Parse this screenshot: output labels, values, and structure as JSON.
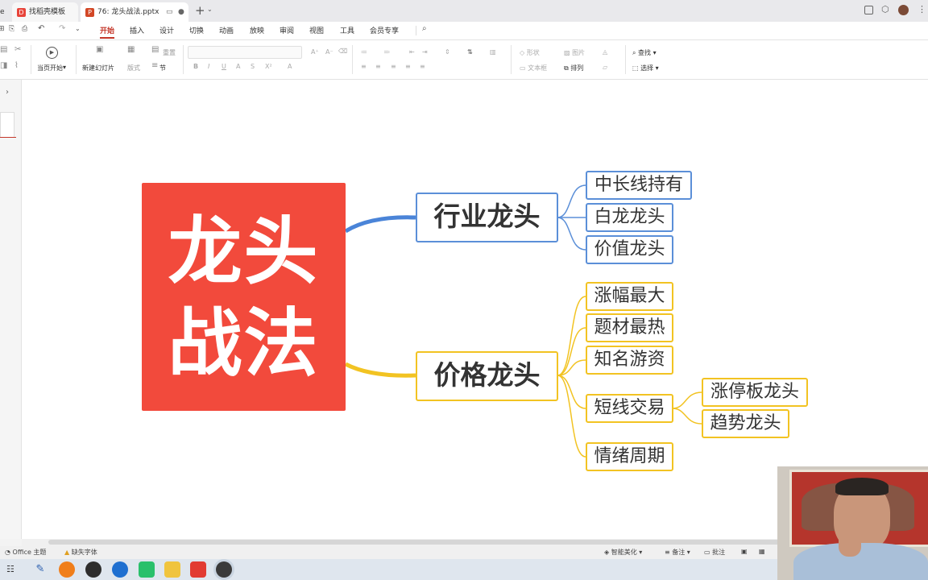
{
  "tabs": [
    {
      "label": "e"
    },
    {
      "label": "找稻壳模板"
    },
    {
      "label": "76: 龙头战法.pptx"
    }
  ],
  "menu": [
    "开始",
    "插入",
    "设计",
    "切换",
    "动画",
    "放映",
    "审阅",
    "视图",
    "工具",
    "会员专享"
  ],
  "ribbon": {
    "play_from_start": "当页开始",
    "new_slide": "新建幻灯片",
    "layout": "版式",
    "section": "节",
    "reset": "重置",
    "shape": "形状",
    "picture": "图片",
    "textbox": "文本框",
    "arrange": "排列",
    "find": "查找",
    "select": "选择"
  },
  "mindmap": {
    "root": "龙头战法",
    "root_line1": "龙头",
    "root_line2": "战法",
    "branch_industry": {
      "title": "行业龙头",
      "children": [
        "中长线持有",
        "白龙龙头",
        "价值龙头"
      ]
    },
    "branch_price": {
      "title": "价格龙头",
      "children": [
        "涨幅最大",
        "题材最热",
        "知名游资",
        "短线交易",
        "情绪周期"
      ],
      "short_trade_children": [
        "涨停板龙头",
        "趋势龙头"
      ]
    },
    "colors": {
      "root": "#f24a3c",
      "industry": "#5b8fd8",
      "price": "#f2c322"
    }
  },
  "statusbar": {
    "theme": "Office 主题",
    "missing_font": "缺失字体",
    "beautify": "智能美化",
    "notes": "备注",
    "comments": "批注"
  }
}
